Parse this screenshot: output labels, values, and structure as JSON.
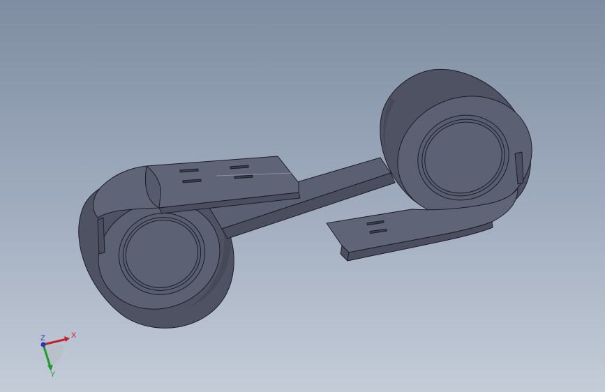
{
  "viewport": {
    "background_top": "#7e8da1",
    "background_bottom": "#c4ccd8"
  },
  "model": {
    "body_color": "#585d6e",
    "face_color": "#5f6477",
    "edge_color": "#1b1d26",
    "highlight_color": "#8a90a3"
  },
  "triad": {
    "x_label": "X",
    "y_label": "Y",
    "z_label": "Z",
    "x_color": "#c0222a",
    "y_color": "#1f9a2b",
    "z_color": "#2438b8"
  }
}
